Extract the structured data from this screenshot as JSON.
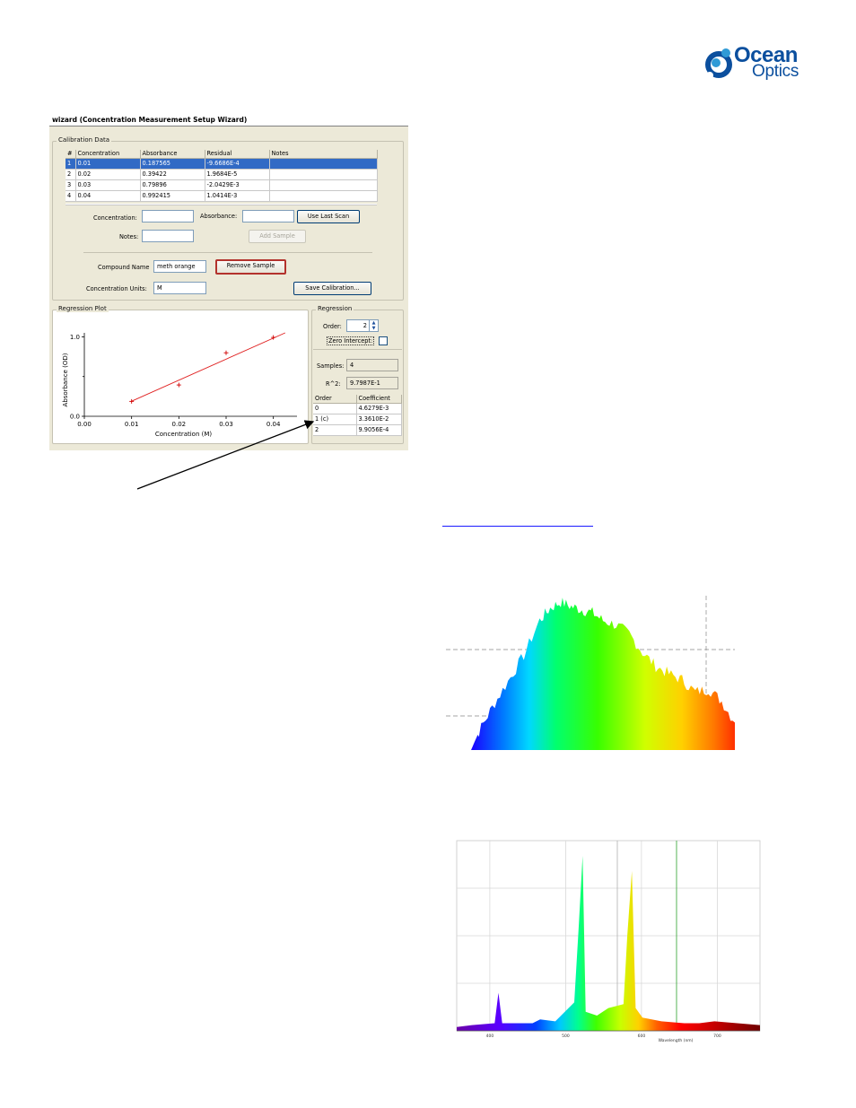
{
  "logo": {
    "line1": "Ocean",
    "line2": "Optics"
  },
  "dialog": {
    "title": "wizard (Concentration Measurement Setup Wizard)",
    "calibration_group_label": "Calibration Data",
    "table": {
      "columns": [
        "#",
        "Concentration",
        "Absorbance",
        "Residual",
        "Notes"
      ],
      "rows": [
        [
          "1",
          "0.01",
          "0.187565",
          "-9.6686E-4",
          ""
        ],
        [
          "2",
          "0.02",
          "0.39422",
          "1.9684E-5",
          ""
        ],
        [
          "3",
          "0.03",
          "0.79896",
          "-2.0429E-3",
          ""
        ],
        [
          "4",
          "0.04",
          "0.992415",
          "1.0414E-3",
          ""
        ]
      ],
      "selected_row": 0
    },
    "concentration_label": "Concentration:",
    "concentration_value": "",
    "absorbance_label": "Absorbance:",
    "absorbance_value": "",
    "use_last_scan_label": "Use Last Scan",
    "notes_label": "Notes:",
    "notes_value": "",
    "add_sample_label": "Add Sample",
    "compound_name_label": "Compound Name",
    "compound_name_value": "meth orange",
    "remove_sample_label": "Remove Sample",
    "concentration_units_label": "Concentration Units:",
    "concentration_units_value": "M",
    "save_calibration_label": "Save Calibration...",
    "regression_plot_label": "Regression Plot",
    "regression_group_label": "Regression",
    "order_label": "Order:",
    "order_value": "2",
    "zero_intercept_label": "Zero Intercept:",
    "samples_label": "Samples:",
    "samples_value": "4",
    "r2_label": "R^2:",
    "r2_value": "9.7987E-1",
    "coef_table": {
      "columns": [
        "Order",
        "Coefficient"
      ],
      "rows": [
        [
          "0",
          "4.6279E-3"
        ],
        [
          "1 (c)",
          "3.3610E-2"
        ],
        [
          "2",
          "9.9056E-4"
        ]
      ]
    }
  },
  "chart_data": [
    {
      "type": "scatter",
      "title": "",
      "xlabel": "Concentration (M)",
      "ylabel": "Absorbance (OD)",
      "xlim": [
        0.0,
        0.045
      ],
      "ylim": [
        0.0,
        1.05
      ],
      "xticks": [
        "0.00",
        "0.01",
        "0.02",
        "0.03",
        "0.04"
      ],
      "yticks": [
        "0.0",
        "1.0"
      ],
      "points": {
        "x": [
          0.01,
          0.02,
          0.03,
          0.04
        ],
        "y": [
          0.187565,
          0.39422,
          0.79896,
          0.992415
        ]
      },
      "fit_line": {
        "x": [
          0.01,
          0.0425
        ],
        "y": [
          0.19,
          1.05
        ]
      },
      "point_color": "#d00000",
      "fit_color": "#e02020"
    },
    {
      "type": "area",
      "title": "",
      "xlabel": "",
      "ylabel": "",
      "note": "continuous broadband spectrum filled with spectral (wavelength) colors",
      "x": [
        0,
        0.03,
        0.08,
        0.14,
        0.2,
        0.26,
        0.3,
        0.34,
        0.38,
        0.42,
        0.46,
        0.5,
        0.55,
        0.6,
        0.65,
        0.7,
        0.75,
        0.8,
        0.85,
        0.9,
        0.95,
        1.0
      ],
      "values": [
        0.0,
        0.12,
        0.28,
        0.45,
        0.62,
        0.85,
        0.93,
        0.97,
        0.94,
        0.92,
        0.9,
        0.85,
        0.82,
        0.76,
        0.64,
        0.55,
        0.5,
        0.46,
        0.38,
        0.4,
        0.32,
        0.18
      ]
    },
    {
      "type": "area",
      "title": "",
      "xlabel": "Wavelength (nm)",
      "ylabel": "",
      "xticks": [
        "400",
        "500",
        "600",
        "700"
      ],
      "note": "line emission spectrum filled with spectral colors",
      "x": [
        380,
        400,
        430,
        435,
        440,
        480,
        490,
        510,
        535,
        541,
        546,
        550,
        565,
        580,
        600,
        605,
        611,
        616,
        625,
        650,
        680,
        700,
        720,
        750,
        780
      ],
      "values": [
        0.02,
        0.03,
        0.04,
        0.2,
        0.04,
        0.04,
        0.06,
        0.05,
        0.15,
        0.55,
        0.92,
        0.1,
        0.08,
        0.12,
        0.14,
        0.5,
        0.84,
        0.12,
        0.07,
        0.05,
        0.04,
        0.04,
        0.05,
        0.04,
        0.03
      ]
    }
  ]
}
